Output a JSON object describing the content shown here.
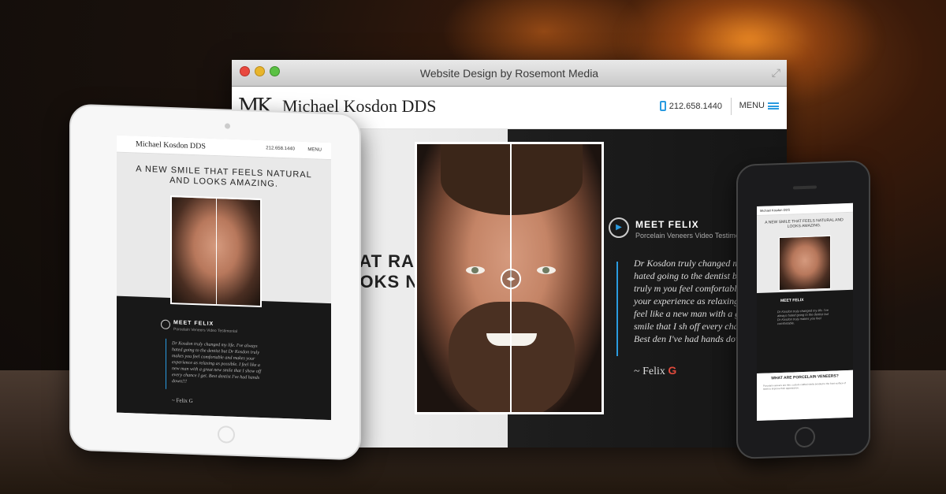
{
  "browser": {
    "title": "Website Design by Rosemont Media"
  },
  "site": {
    "logo_mark": "MK",
    "logo_name": "Michael Kosdon DDS",
    "phone": "212.658.1440",
    "menu_label": "MENU",
    "headline": "THAT RAL LOOKS NG.",
    "testimonial": {
      "title": "MEET FELIX",
      "subtitle": "Porcelain Veneers Video Testimoni",
      "quote": "Dr Kosdon truly changed my I've always hated going to the dentist but Dr Kosdon truly m you feel comfortable and make your experience as relaxing as possible. I feel like a new man with a great new smile that I sh off every chance I get. Best den I've had hands down!!!",
      "signature": "~ Felix",
      "google_mark": "G"
    }
  },
  "tablet": {
    "logo": "Michael Kosdon DDS",
    "phone": "212.658.1440",
    "menu": "MENU",
    "headline": "A NEW SMILE THAT FEELS NATURAL AND LOOKS AMAZING.",
    "meet": "MEET FELIX",
    "sub": "Porcelain Veneers Video Testimonial",
    "quote": "Dr Kosdon truly changed my life. I've always hated going to the dentist but Dr Kosdon truly makes you feel comfortable and makes your experience as relaxing as possible. I feel like a new man with a great new smile that I show off every chance I get. Best dentist I've had hands down!!!",
    "signature": "~ Felix G"
  },
  "phone_device": {
    "header": "Michael Kosdon DDS",
    "headline": "A NEW SMILE THAT FEELS NATURAL AND LOOKS AMAZING.",
    "meet": "MEET FELIX",
    "quote": "Dr Kosdon truly changed my life. I've always hated going to the dentist but Dr Kosdon truly makes you feel comfortable.",
    "what_title": "WHAT ARE PORCELAIN VENEERS?",
    "what_text": "Porcelain veneers are thin, custom-crafted shells bonded to the front surface of teeth to improve their appearance."
  },
  "colors": {
    "accent": "#2a9be0",
    "dark_panel": "#181818",
    "google_red": "#e04a3c"
  }
}
